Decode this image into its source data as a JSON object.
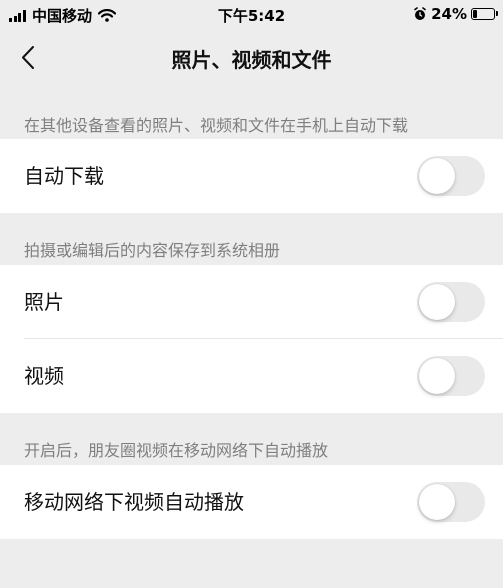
{
  "status_bar": {
    "carrier": "中国移动",
    "time": "下午5:42",
    "battery_percent": "24%",
    "battery_level": 0.24,
    "icons": [
      "signal-icon",
      "wifi-icon",
      "alarm-icon",
      "battery-icon"
    ]
  },
  "nav": {
    "title": "照片、视频和文件",
    "back_icon": "chevron-left-icon"
  },
  "sections": {
    "auto_download": {
      "caption": "在其他设备查看的照片、视频和文件在手机上自动下载",
      "rows": [
        {
          "label": "自动下载",
          "on": false
        }
      ]
    },
    "save_to_album": {
      "caption": "拍摄或编辑后的内容保存到系统相册",
      "rows": [
        {
          "label": "照片",
          "on": false
        },
        {
          "label": "视频",
          "on": false
        }
      ]
    },
    "moments_autoplay": {
      "caption": "开启后，朋友圈视频在移动网络下自动播放",
      "rows": [
        {
          "label": "移动网络下视频自动播放",
          "on": false
        }
      ]
    }
  },
  "colors": {
    "background": "#ededed",
    "card": "#ffffff",
    "caption": "#7f7f7f",
    "toggle_off": "#e9e9ea"
  }
}
